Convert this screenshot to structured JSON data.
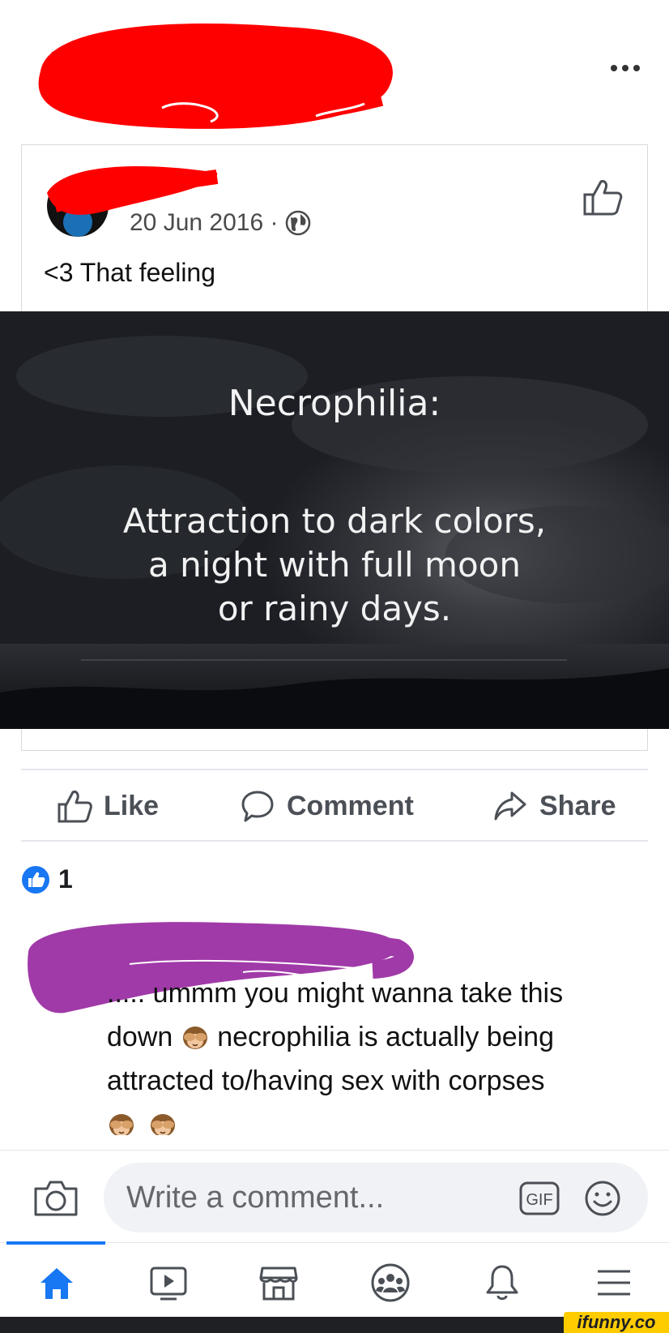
{
  "post": {
    "more_icon": "more-options-icon",
    "shared": {
      "date": "20 Jun 2016 ·",
      "text": "<3 That feeling",
      "icons": [
        "globe-icon",
        "thumbs-up-outline-icon"
      ]
    },
    "image": {
      "heading": "Necrophilia:",
      "lines": [
        "Attraction to dark colors,",
        "a night with full moon",
        "or rainy days."
      ]
    }
  },
  "actions": {
    "like_label": "Like",
    "comment_label": "Comment",
    "share_label": "Share"
  },
  "reactions": {
    "count": "1"
  },
  "comment": {
    "lines": [
      "..... ummm you might wanna take this",
      "necrophilia is actually being",
      "attracted to/having sex with corpses"
    ],
    "line2_prefix": "down",
    "emoji": "see-no-evil-monkey-icon"
  },
  "composer": {
    "placeholder": "Write a comment...",
    "gif_label": "GIF"
  },
  "tabbar": {
    "tabs": [
      "home-icon",
      "video-icon",
      "marketplace-icon",
      "groups-icon",
      "notifications-icon",
      "menu-icon"
    ],
    "active": "home-icon"
  },
  "watermark": "ifunny.co",
  "colors": {
    "accent": "#1877f2",
    "redaction_top": "#ff0000",
    "redaction_comment": "#a03aa8",
    "watermark_bg": "#ffcc00"
  }
}
